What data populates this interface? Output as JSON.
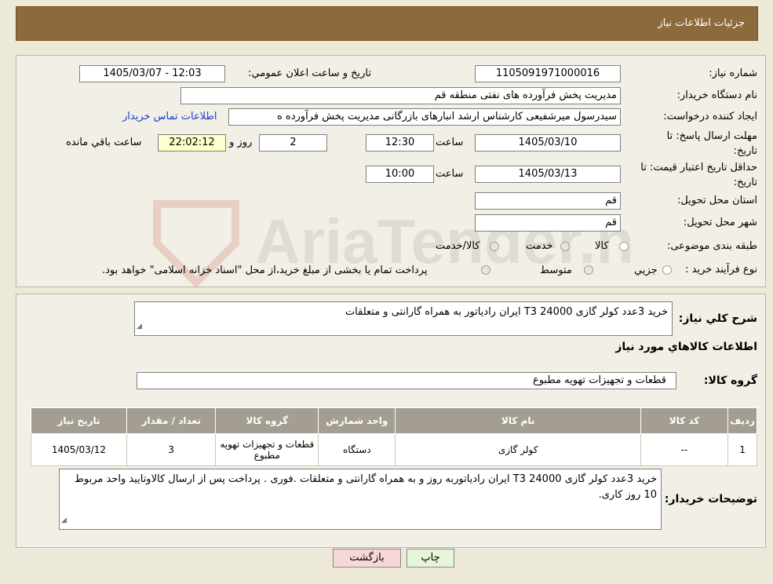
{
  "header": {
    "title": "جزئیات اطلاعات نیاز"
  },
  "fields": {
    "need_number_label": "شماره نياز:",
    "need_number_value": "1105091971000016",
    "announce_label": "تاريخ و ساعت اعلان عمومي:",
    "announce_value": "1405/03/07 - 12:03",
    "buyer_org_label": "نام دستگاه خريدار:",
    "buyer_org_value": "مدیریت پخش فرآورده های نفتی منطقه قم",
    "requester_label": "ايجاد كننده درخواست:",
    "requester_value": "سیدرسول میرشفیعی کارشناس ارشد انبارهای بازرگانی مدیریت پخش فرآورده ه",
    "contact_link": "اطلاعات تماس خریدار",
    "deadline_label_line1": "مهلت ارسال پاسخ: تا",
    "deadline_label_line2": "تاريخ:",
    "deadline_date": "1405/03/10",
    "time_label": "ساعت",
    "deadline_time": "12:30",
    "days_value": "2",
    "days_label": "روز و",
    "remaining_time": "22:02:12",
    "remaining_label": "ساعت باقي مانده",
    "validity_label_line1": "حداقل تاريخ اعتبار قيمت: تا",
    "validity_label_line2": "تاريخ:",
    "validity_date": "1405/03/13",
    "validity_time": "10:00",
    "province_label": "استان محل تحويل:",
    "province_value": "قم",
    "city_label": "شهر محل تحويل:",
    "city_value": "قم",
    "category_label": "طبقه بندی موضوعی:",
    "category_options": [
      "کالا",
      "خدمت",
      "کالا/خدمت"
    ],
    "process_label": "نوع فرآيند خريد :",
    "process_options": [
      "جزیي",
      "متوسط"
    ],
    "process_note": "پرداخت تمام یا بخشی از مبلغ خرید،از محل \"اسناد خزانه اسلامی\" خواهد بود."
  },
  "summary": {
    "label": "شرح كلي نياز:",
    "value": "خرید 3عدد کولر گازی 24000    T3 ایران رادیاتور به همراه گارانتی و متعلقات",
    "goods_info_title": "اطلاعات كالاهاي مورد نياز",
    "group_label": "گروه كالا:",
    "group_value": "قطعات و تجهیزات تهویه مطبوع"
  },
  "table": {
    "headers": [
      "رديف",
      "كد كالا",
      "نام كالا",
      "واحد شمارش",
      "گروه كالا",
      "تعداد / مقدار",
      "تاريخ نياز"
    ],
    "rows": [
      [
        "1",
        "--",
        "کولر گازی",
        "دستگاه",
        "قطعات و تجهیزات تهویه مطبوع",
        "3",
        "1405/03/12"
      ]
    ]
  },
  "buyer_notes": {
    "label": "توضيحات خريدار:",
    "value": "خرید 3عدد کولر گازی 24000    T3 ایران رادیاتوربه روز و به همراه گارانتی و متعلقات  .فوری . پرداخت پس از ارسال کالاوتایید واحد مربوط 10 روز کاری."
  },
  "buttons": {
    "print": "چاپ",
    "back": "بازگشت"
  },
  "colors": {
    "header_bg": "#8c6a3b",
    "table_header_bg": "#a39e91",
    "link": "#1a3fcc",
    "back_button_bg": "#f8d7d7",
    "print_button_bg": "#e6f5d8"
  },
  "watermark": {
    "text": "AriaTender.neT"
  }
}
